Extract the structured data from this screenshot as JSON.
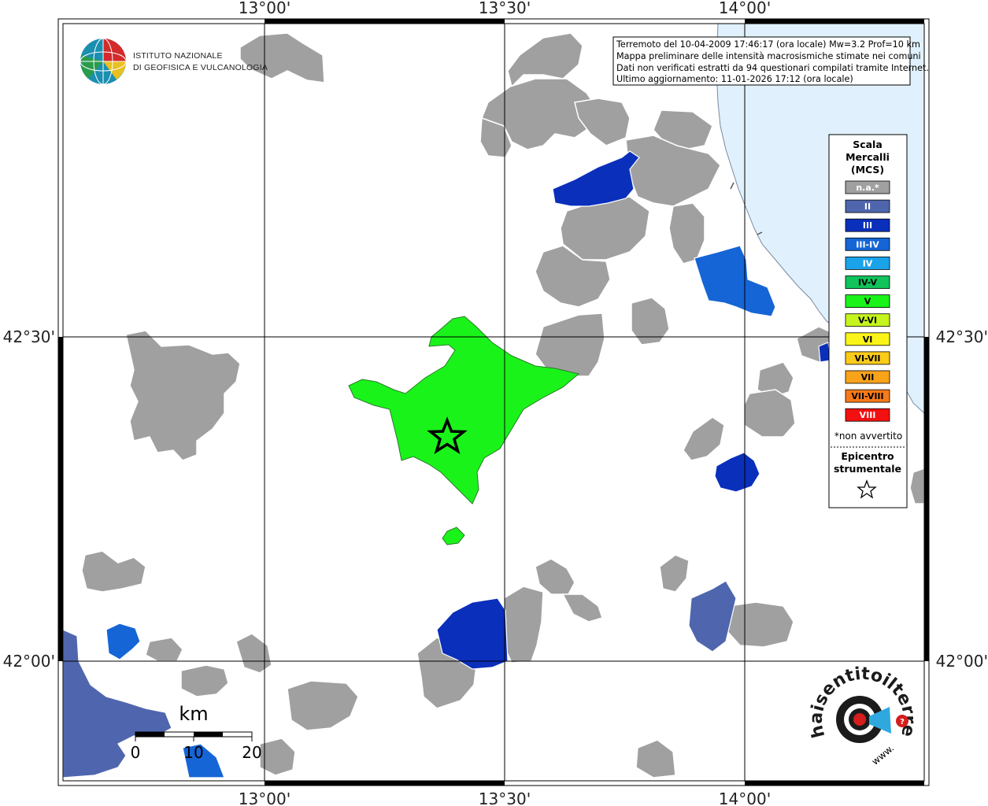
{
  "map": {
    "x_ticks": [
      "13°00'",
      "13°30'",
      "14°00'"
    ],
    "y_ticks": [
      "42°30'",
      "42°00'"
    ]
  },
  "organization": {
    "line1": "ISTITUTO NAZIONALE",
    "line2": "DI GEOFISICA E VULCANOLOGIA"
  },
  "info": {
    "line1": "Terremoto del 10-04-2009 17:46:17 (ora locale) Mw=3.2 Prof=10 km",
    "line2": "Mappa preliminare delle intensità macrosismiche stimate nei comuni",
    "line3": "Dati non verificati estratti da 94 questionari compilati tramite Internet.",
    "line4": "Ultimo aggiornamento: 11-01-2026 17:12 (ora locale)"
  },
  "legend": {
    "title1": "Scala",
    "title2": "Mercalli",
    "title3": "(MCS)",
    "items": [
      {
        "label": "n.a.*",
        "color": "#a0a0a0",
        "text_color": "#ffffff"
      },
      {
        "label": "II",
        "color": "#4f66ae",
        "text_color": "#ffffff"
      },
      {
        "label": "III",
        "color": "#0a2fbb",
        "text_color": "#ffffff"
      },
      {
        "label": "III-IV",
        "color": "#1565d6",
        "text_color": "#ffffff"
      },
      {
        "label": "IV",
        "color": "#1ba3ea",
        "text_color": "#ffffff"
      },
      {
        "label": "IV-V",
        "color": "#10c35a",
        "text_color": "#000000"
      },
      {
        "label": "V",
        "color": "#1af31a",
        "text_color": "#000000"
      },
      {
        "label": "V-VI",
        "color": "#c6f41d",
        "text_color": "#000000"
      },
      {
        "label": "VI",
        "color": "#fbf418",
        "text_color": "#000000"
      },
      {
        "label": "VI-VII",
        "color": "#fbcb1a",
        "text_color": "#000000"
      },
      {
        "label": "VII",
        "color": "#f9a31a",
        "text_color": "#000000"
      },
      {
        "label": "VII-VIII",
        "color": "#f77a1a",
        "text_color": "#000000"
      },
      {
        "label": "VIII",
        "color": "#f21010",
        "text_color": "#ffffff"
      }
    ],
    "note": "*non avvertito",
    "epicenter1": "Epicentro",
    "epicenter2": "strumentale"
  },
  "scale_bar": {
    "unit": "km",
    "labels": [
      "0",
      "10",
      "20"
    ]
  },
  "brand": {
    "text": "haisentitoilterremoto.it",
    "prefix": "www."
  },
  "colors": {
    "not_available": "#a0a0a0",
    "II": "#4f66ae",
    "III": "#0a2fbb",
    "III_IV": "#1565d6",
    "V": "#1af31a",
    "sea": "#e0f1fd",
    "grid": "#000000"
  }
}
